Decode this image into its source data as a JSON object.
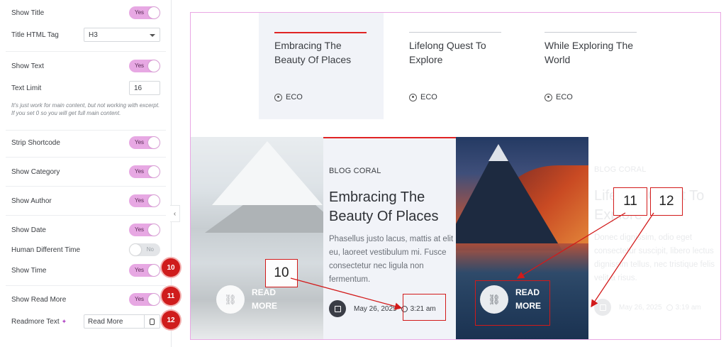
{
  "panel": {
    "show_title": {
      "label": "Show Title",
      "value": "Yes"
    },
    "title_tag": {
      "label": "Title HTML Tag",
      "value": "H3"
    },
    "show_text": {
      "label": "Show Text",
      "value": "Yes"
    },
    "text_limit": {
      "label": "Text Limit",
      "value": "16"
    },
    "help": "It's just work for main content, but not working with excerpt. If you set 0 so you will get full main content.",
    "strip_shortcode": {
      "label": "Strip Shortcode",
      "value": "Yes"
    },
    "show_category": {
      "label": "Show Category",
      "value": "Yes"
    },
    "show_author": {
      "label": "Show Author",
      "value": "Yes"
    },
    "show_date": {
      "label": "Show Date",
      "value": "Yes"
    },
    "human_time": {
      "label": "Human Different Time",
      "value": "No"
    },
    "show_time": {
      "label": "Show Time",
      "value": "Yes"
    },
    "show_read_more": {
      "label": "Show Read More",
      "value": "Yes"
    },
    "readmore_text": {
      "label": "Readmore Text",
      "value": "Read More"
    },
    "collapse_icon": "chevron-left-icon"
  },
  "badges": {
    "b10": "10",
    "b11": "11",
    "b12": "12"
  },
  "preview": {
    "top_cards": [
      {
        "title": "Embracing The Beauty Of Places",
        "category": "ECO"
      },
      {
        "title": "Lifelong Quest To Explore",
        "category": "ECO"
      },
      {
        "title": "While Exploring The World",
        "category": "ECO"
      }
    ],
    "read_more": {
      "line1": "READ",
      "line2": "MORE"
    },
    "main_card": {
      "category": "BLOG CORAL",
      "title": "Embracing The Beauty Of Places",
      "body": "Phasellus justo lacus, mattis at elit eu, laoreet vestibulum mi. Fusce consectetur nec ligula non fermentum.",
      "date": "May 26, 2025",
      "time": "3:21 am"
    },
    "faded_card": {
      "category": "BLOG CORAL",
      "title": "Lifelong Quest To Explore",
      "body": "Donec dignissim, odio eget consectetur suscipit, libero lectus dignissim tellus, nec tristique felis velit a risus.",
      "date": "May 26, 2025",
      "time": "3:19 am"
    },
    "annotations": {
      "a10": "10",
      "a11": "11",
      "a12": "12"
    }
  },
  "colors": {
    "accent": "#e02424",
    "toggle_on": "#e7a8e3",
    "badge": "#cf1c1c",
    "preview_border": "#e9a7e4"
  }
}
